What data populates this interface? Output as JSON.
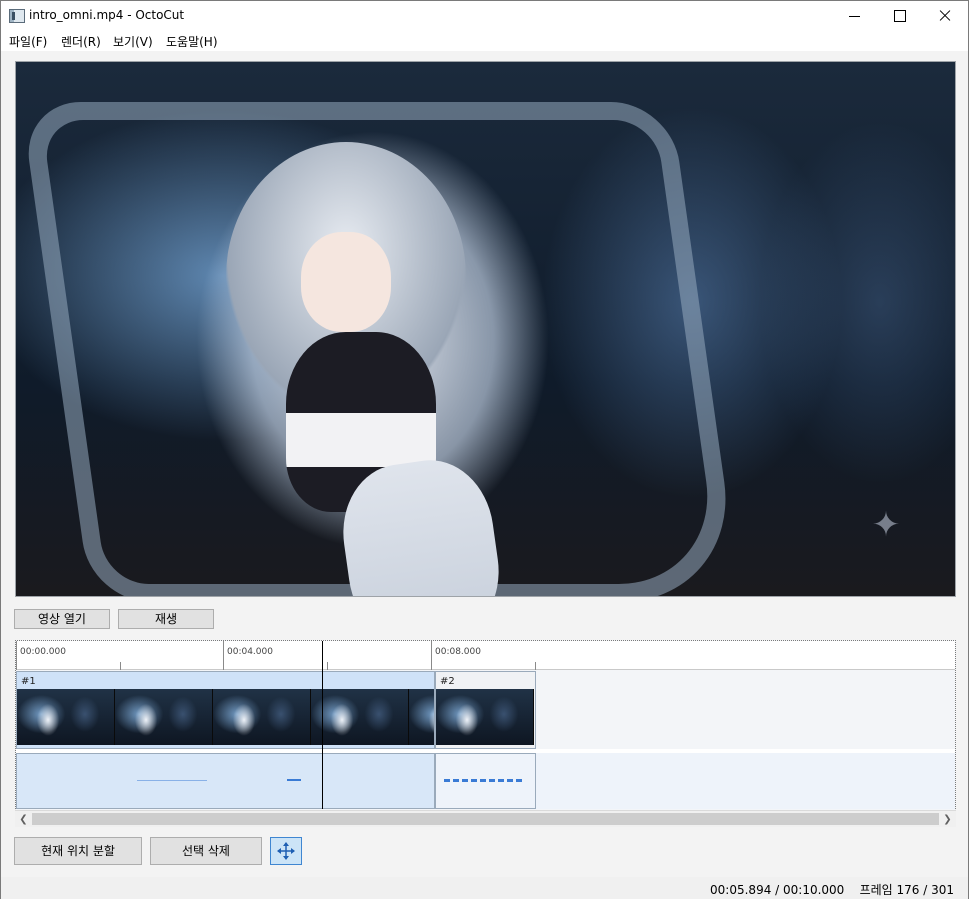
{
  "window": {
    "title": "intro_omni.mp4 - OctoCut"
  },
  "menu": [
    {
      "label": "파일(F)"
    },
    {
      "label": "렌더(R)"
    },
    {
      "label": "보기(V)"
    },
    {
      "label": "도움말(H)"
    }
  ],
  "player": {
    "open_label": "영상 열기",
    "play_label": "재생"
  },
  "timeline": {
    "ruler": [
      "00:00.000",
      "00:04.000",
      "00:08.000"
    ],
    "clips": [
      {
        "label": "#1"
      },
      {
        "label": "#2"
      }
    ]
  },
  "actions": {
    "split_label": "현재 위치 분할",
    "delete_label": "선택 삭제",
    "snap_icon": "move-arrows-icon"
  },
  "status": {
    "time": "00:05.894 / 00:10.000",
    "frame": "프레임 176 / 301"
  },
  "icons": {
    "app": "film-icon",
    "sparkle": "sparkle-icon"
  },
  "colors": {
    "accent": "#3f86d1",
    "selection": "#cce4f7",
    "waveform": "#3a7bd5"
  }
}
